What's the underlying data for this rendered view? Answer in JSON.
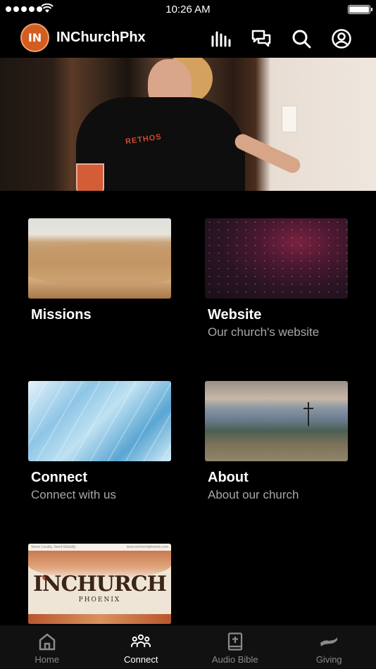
{
  "status_bar": {
    "time": "10:26 AM"
  },
  "header": {
    "logo_text": "IN",
    "title": "INChurchPhx",
    "icons": [
      "equalizer-icon",
      "chat-icon",
      "search-icon",
      "account-icon"
    ]
  },
  "tiles": [
    {
      "title": "Missions",
      "subtitle": ""
    },
    {
      "title": "Website",
      "subtitle": "Our church's website"
    },
    {
      "title": "Connect",
      "subtitle": "Connect with us"
    },
    {
      "title": "About",
      "subtitle": "About our church"
    },
    {
      "title": "",
      "subtitle": ""
    }
  ],
  "poster": {
    "brand": "INCHURCH",
    "brand_sub": "PHOENIX",
    "strip_left": "Serve Locally, Send Globally",
    "strip_right": "www.inchurchphoenix.com"
  },
  "hero": {
    "shirt_text": "RETHOS"
  },
  "tabs": [
    {
      "label": "Home",
      "icon": "home-icon",
      "active": false
    },
    {
      "label": "Connect",
      "icon": "people-icon",
      "active": true
    },
    {
      "label": "Audio Bible",
      "icon": "bible-icon",
      "active": false
    },
    {
      "label": "Giving",
      "icon": "giving-icon",
      "active": false
    }
  ],
  "colors": {
    "accent": "#d35d1f",
    "background": "#000000",
    "subtitle": "#a8a8a8"
  }
}
